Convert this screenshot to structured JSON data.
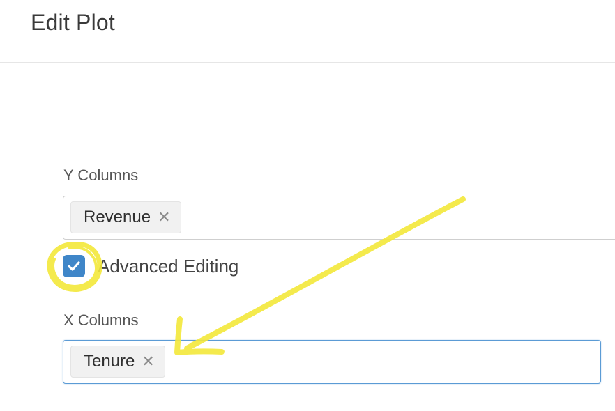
{
  "header": {
    "title": "Edit Plot"
  },
  "form": {
    "y_columns": {
      "label": "Y Columns",
      "selected": [
        "Revenue"
      ]
    },
    "advanced_editing": {
      "label": "Advanced Editing",
      "checked": true
    },
    "x_columns": {
      "label": "X Columns",
      "selected": [
        "Tenure"
      ]
    }
  },
  "icons": {
    "remove": "close-icon",
    "checkbox": "check-icon"
  },
  "colors": {
    "checkbox_fill": "#3f86c8",
    "focus_border": "#5b9bd5",
    "annotation": "#f3e83a"
  }
}
